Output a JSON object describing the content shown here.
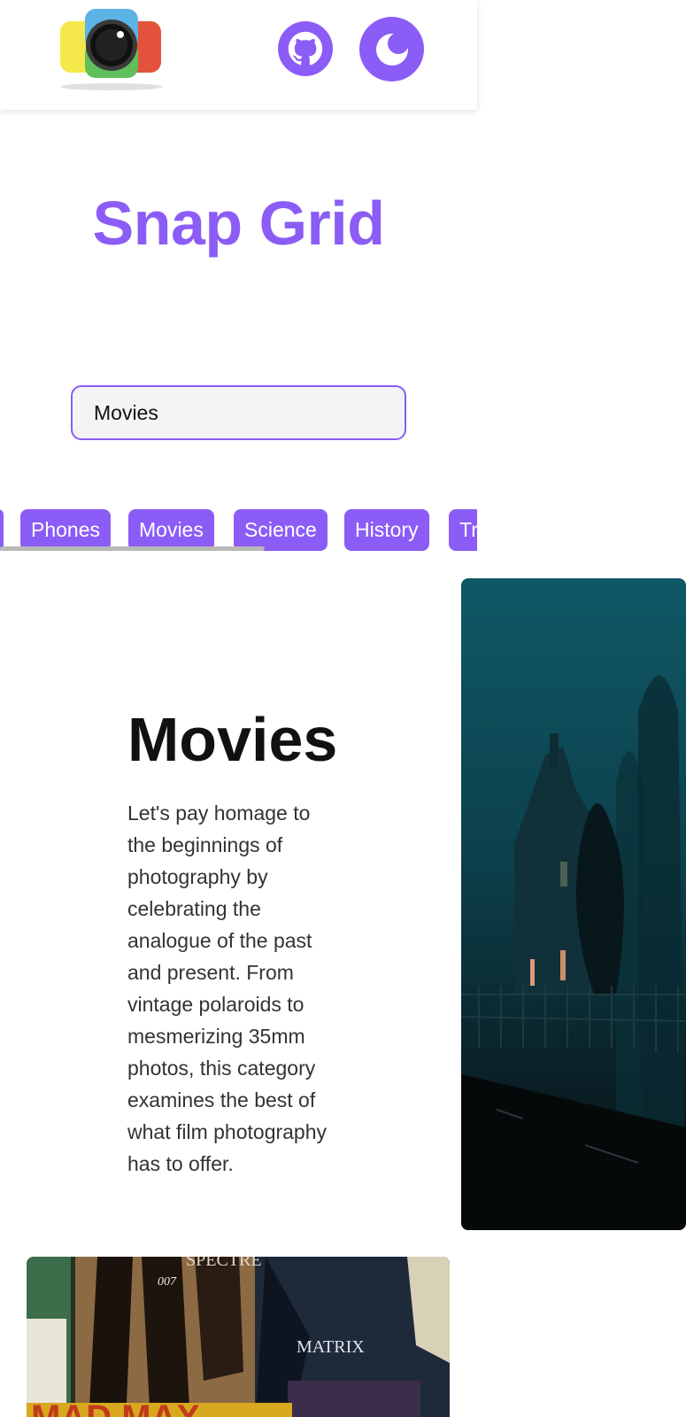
{
  "header": {
    "logo_icon": "camera-logo-icon",
    "github_icon": "github-icon",
    "theme_icon": "moon-icon",
    "accent_color": "#8b5cf6"
  },
  "hero": {
    "title": "Snap Grid"
  },
  "search": {
    "value": "Movies"
  },
  "categories": {
    "items": [
      {
        "label": "Phones"
      },
      {
        "label": "Movies"
      },
      {
        "label": "Science"
      },
      {
        "label": "History"
      },
      {
        "label": "Tr"
      }
    ]
  },
  "category": {
    "title": "Movies",
    "description": "Let's pay homage to the beginnings of photography by celebrating the analogue of the past and present. From vintage polaroids to mesmerizing 35mm photos, this category examines the best of what film photography has to offer."
  },
  "gallery": {
    "posters": {
      "spectre": "SPECTRE",
      "bond": "007",
      "matrix": "MATRIX",
      "madmax": "MAD MAX"
    }
  }
}
